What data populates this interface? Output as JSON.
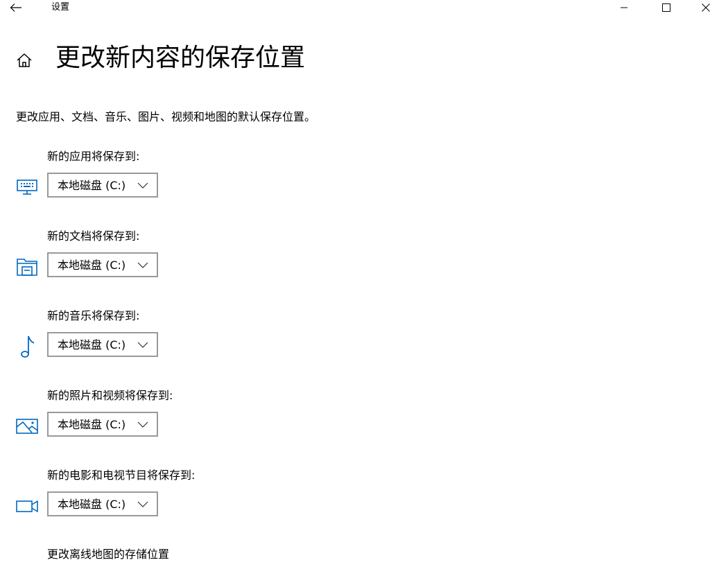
{
  "window": {
    "title": "设置",
    "back_icon": "back-arrow-icon",
    "minimize_icon": "minimize-icon",
    "maximize_icon": "maximize-icon",
    "close_icon": "close-icon"
  },
  "header": {
    "icon": "home-icon",
    "title": "更改新内容的保存位置"
  },
  "description": "更改应用、文档、音乐、图片、视频和地图的默认保存位置。",
  "accent_color": "#0067c0",
  "groups": [
    {
      "label": "新的应用将保存到:",
      "icon": "monitor-icon",
      "value": "本地磁盘 (C:)"
    },
    {
      "label": "新的文档将保存到:",
      "icon": "documents-icon",
      "value": "本地磁盘 (C:)"
    },
    {
      "label": "新的音乐将保存到:",
      "icon": "music-note-icon",
      "value": "本地磁盘 (C:)"
    },
    {
      "label": "新的照片和视频将保存到:",
      "icon": "picture-icon",
      "value": "本地磁盘 (C:)"
    },
    {
      "label": "新的电影和电视节目将保存到:",
      "icon": "video-camera-icon",
      "value": "本地磁盘 (C:)"
    }
  ],
  "offline_maps": {
    "label": "更改离线地图的存储位置"
  }
}
